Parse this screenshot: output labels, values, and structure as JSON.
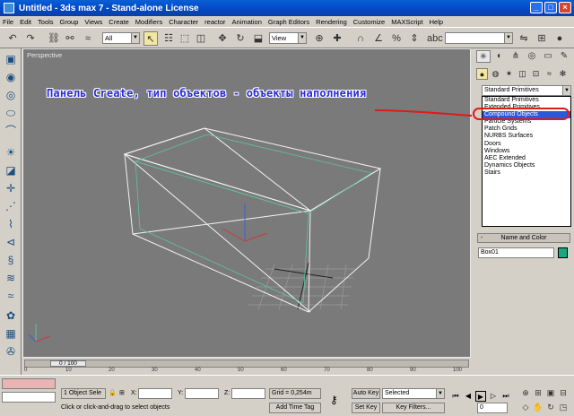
{
  "window": {
    "title": "Untitled - 3ds max 7 - Stand-alone License"
  },
  "menu": [
    "File",
    "Edit",
    "Tools",
    "Group",
    "Views",
    "Create",
    "Modifiers",
    "Character",
    "reactor",
    "Animation",
    "Graph Editors",
    "Rendering",
    "Customize",
    "MAXScript",
    "Help"
  ],
  "toolbar": {
    "selection_filter": "All",
    "ref_coord": "View"
  },
  "viewport": {
    "label": "Perspective",
    "annotation": "Панель Create, тип объектов - объекты наполнения"
  },
  "command_panel": {
    "category_value": "Standard Primitives",
    "dropdown_items": [
      "Standard Primitives",
      "Extended Primitives",
      "Compound Objects",
      "Particle Systems",
      "Patch Grids",
      "NURBS Surfaces",
      "Doors",
      "Windows",
      "AEC Extended",
      "Dynamics Objects",
      "Stairs"
    ],
    "highlighted_index": 2,
    "rollout_title": "Name and Color",
    "rollout_toggle": "-",
    "object_name": "Box01",
    "object_color": "#1ba87e"
  },
  "timeline": {
    "position": "0 / 100",
    "ticks": [
      "0",
      "10",
      "20",
      "30",
      "40",
      "50",
      "60",
      "70",
      "80",
      "90",
      "100"
    ]
  },
  "status": {
    "selection_count": "1 Object Sele",
    "x_label": "X:",
    "y_label": "Y:",
    "z_label": "Z:",
    "grid": "Grid = 0,254m",
    "prompt": "Click or click-and-drag to select objects",
    "add_time_tag": "Add Time Tag",
    "auto_key": "Auto Key",
    "key_mode": "Selected",
    "set_key": "Set Key",
    "key_filters": "Key Filters...",
    "frame": "0"
  },
  "colors": {
    "title_bar": "#0347c3",
    "annotation_text": "#2a2adc",
    "highlight_oval": "#e01a1a",
    "selection": "#2a5ad8"
  }
}
